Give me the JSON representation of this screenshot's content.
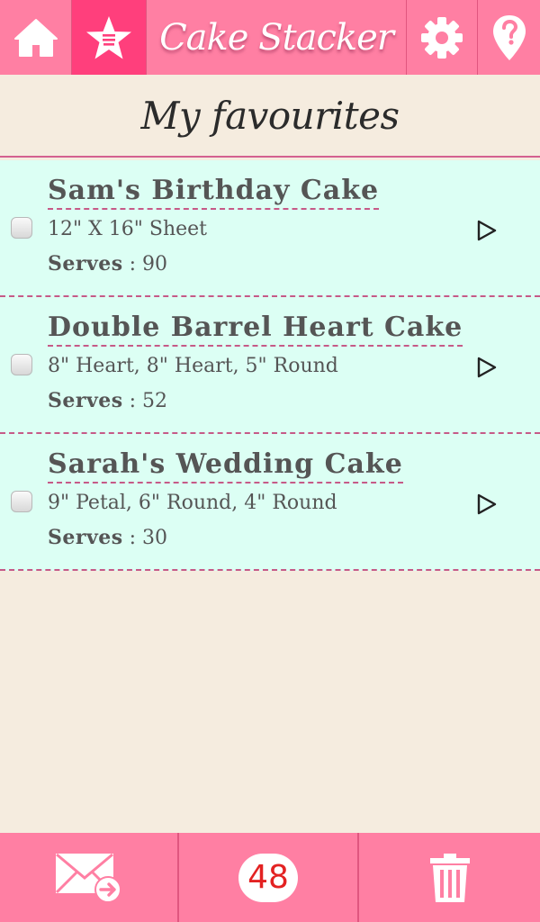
{
  "header": {
    "title": "Cake Stacker",
    "icons": [
      "home-icon",
      "favourites-star-icon",
      "gear-icon",
      "help-icon"
    ]
  },
  "page": {
    "title": "My favourites"
  },
  "favourites": [
    {
      "name": "Sam's Birthday Cake",
      "sizes": "12\" X 16\" Sheet",
      "serves_label": "Serves",
      "serves_value": " : 90"
    },
    {
      "name": "Double Barrel Heart Cake",
      "sizes": "8\" Heart, 8\" Heart, 5\" Round",
      "serves_label": "Serves",
      "serves_value": " : 52"
    },
    {
      "name": "Sarah's Wedding Cake",
      "sizes": "9\" Petal, 6\" Round, 4\" Round",
      "serves_label": "Serves",
      "serves_value": " : 30"
    }
  ],
  "footer": {
    "count_badge": "48",
    "icons": [
      "email-send-icon",
      "trash-icon"
    ]
  },
  "colors": {
    "header_bg": "#ff7fa3",
    "active_tab": "#ff3f7c",
    "page_bg": "#f5ecdf",
    "row_bg": "#dcfff4",
    "divider": "#c65a87",
    "badge_text": "#e32222"
  }
}
